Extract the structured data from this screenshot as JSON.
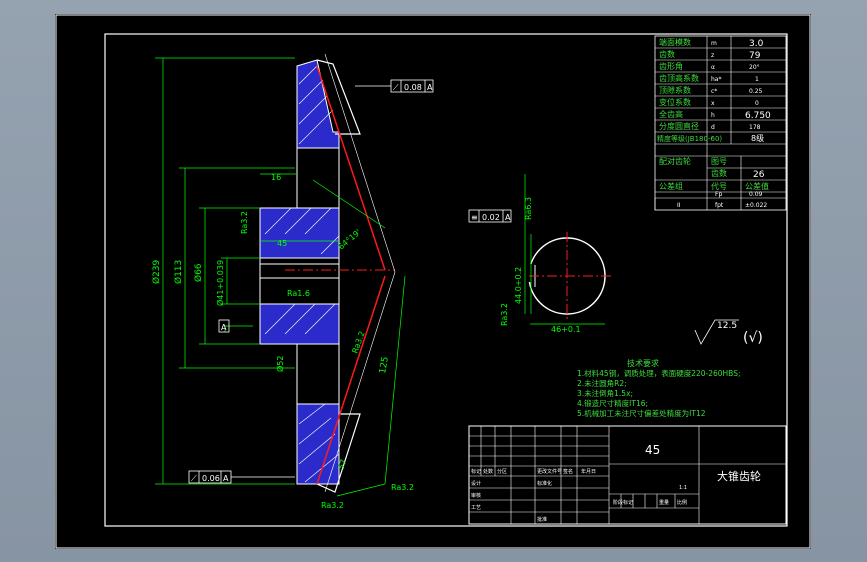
{
  "colors": {
    "background": "#000000",
    "frame": "#ffffff",
    "dimension": "#00ff00",
    "gear_body": "#2b2bcc",
    "center_line": "#ff1a1a",
    "note_text": "#3ddc3d"
  },
  "params_table": {
    "rows": [
      {
        "label": "端面模数",
        "symbol": "m",
        "value": "3.0"
      },
      {
        "label": "齿数",
        "symbol": "z",
        "value": "79"
      },
      {
        "label": "齿形角",
        "symbol": "α",
        "value": "20°"
      },
      {
        "label": "齿顶高系数",
        "symbol": "ha*",
        "value": "1"
      },
      {
        "label": "顶隙系数",
        "symbol": "c*",
        "value": "0.25"
      },
      {
        "label": "变位系数",
        "symbol": "x",
        "value": "0"
      },
      {
        "label": "全齿高",
        "symbol": "h",
        "value": "6.750"
      },
      {
        "label": "分度圆直径",
        "symbol": "d",
        "value": "178"
      }
    ],
    "precision_label": "精度等级(JB180-60)",
    "precision_value": "8级",
    "mating_label": "配对齿轮",
    "mating_sub1": "图号",
    "mating_sub2": "齿数",
    "mating_teeth": "26",
    "tolerance_label": "公差组",
    "tol_col2": "代号",
    "tol_col3": "公差值",
    "tol_row1_sym": "Fp",
    "tol_row1_val": "0.09",
    "tol_row2_group": "II",
    "tol_row2_sym": "fpt",
    "tol_row2_val": "±0.022"
  },
  "tech_req": {
    "title": "技术要求",
    "lines": [
      "1.材料45钢，调质处理，表面硬度220-260HBS;",
      "2.未注圆角R2;",
      "3.未注倒角1.5x;",
      "4.锻造尺寸精度IT16;",
      "5.机械加工未注尺寸偏差处精度为IT12"
    ]
  },
  "title_block": {
    "material": "45",
    "part_name": "大锥齿轮",
    "cells": [
      "标记",
      "处数",
      "分区",
      "更改文件号",
      "签名",
      "年月日",
      "阶段标记",
      "重量",
      "比例",
      "1:1",
      "设计",
      "标准化",
      "审核",
      "工艺",
      "批准"
    ]
  },
  "dims": {
    "d239": "Ø239",
    "d113": "Ø113",
    "d66": "Ø66",
    "d41": "Ø41+0.039",
    "d52": "Ø52",
    "w16": "16",
    "w45": "45",
    "ra16": "Ra1.6",
    "ra32a": "Ra3.2",
    "ra32b": "Ra3.2",
    "ra32c": "Ra3.2",
    "ra32d": "Ra3.2",
    "ra63": "Ra6.3",
    "dist125": "125",
    "ang": "64°19'",
    "ang2": "57",
    "tol_top_sym": "⟋",
    "tol_top_val": "0.08",
    "tol_top_ref": "A",
    "tol_bot_sym": "⟋",
    "tol_bot_val": "0.06",
    "tol_bot_ref": "A",
    "datum": "A",
    "key_tol_sym": "≡",
    "key_tol_val": "0.02",
    "key_tol_ref": "A",
    "key_depth": "44.0+0.2",
    "key_width": "46+0.1",
    "ra32_key": "Ra3.2",
    "rough_all": "12.5",
    "rough_check": "(√)"
  }
}
